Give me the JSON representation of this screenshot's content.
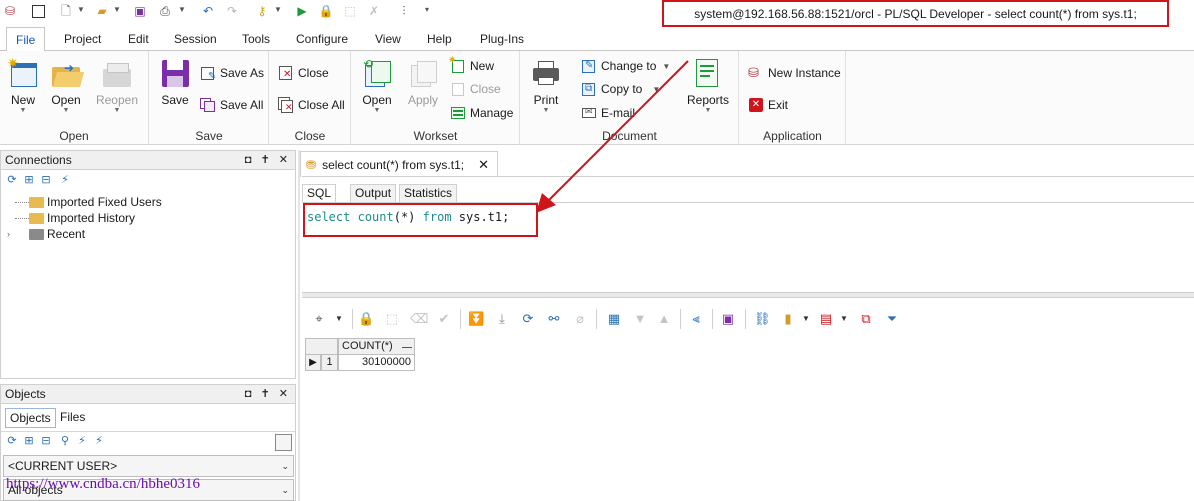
{
  "window": {
    "title": "system@192.168.56.88:1521/orcl - PL/SQL Developer - select count(*) from sys.t1;"
  },
  "ribbon_tabs": [
    "File",
    "Project",
    "Edit",
    "Session",
    "Tools",
    "Configure",
    "View",
    "Help",
    "Plug-Ins"
  ],
  "ribbon": {
    "open_group": {
      "caption": "Open",
      "new": "New",
      "open": "Open",
      "reopen": "Reopen"
    },
    "save_group": {
      "caption": "Save",
      "save": "Save",
      "save_as": "Save As",
      "save_all": "Save All"
    },
    "close_group": {
      "caption": "Close",
      "close": "Close",
      "close_all": "Close All"
    },
    "workset_group": {
      "caption": "Workset",
      "open": "Open",
      "apply": "Apply",
      "new": "New",
      "close": "Close",
      "manage": "Manage"
    },
    "document_group": {
      "caption": "Document",
      "print": "Print",
      "change_to": "Change to",
      "copy_to": "Copy to",
      "email": "E-mail",
      "reports": "Reports"
    },
    "application_group": {
      "caption": "Application",
      "new_instance": "New Instance",
      "exit": "Exit"
    }
  },
  "connections": {
    "title": "Connections",
    "controls": "◘ ✝ ✕",
    "items": [
      {
        "label": "Imported Fixed Users"
      },
      {
        "label": "Imported History"
      },
      {
        "label": "Recent"
      }
    ]
  },
  "objects": {
    "title": "Objects",
    "controls": "◘ ✝ ✕",
    "tabs": [
      "Objects",
      "Files"
    ],
    "user_combo": "<CURRENT USER>",
    "filter_combo": "All objects"
  },
  "editor": {
    "doc_tab_label": "select count(*) from sys.t1;",
    "sub_tabs": [
      "SQL",
      "Output",
      "Statistics"
    ],
    "sql": {
      "kw_select": "select",
      "fn_count": "count",
      "paren": "(*)",
      "kw_from": "from",
      "object": "sys.t1;"
    }
  },
  "result_grid": {
    "columns": [
      "COUNT(*)"
    ],
    "rows": [
      {
        "num": "1",
        "values": [
          "30100000"
        ]
      }
    ]
  },
  "watermark": "https://www.cndba.cn/hbhe0316",
  "colors": {
    "annotation_red": "#d0141b",
    "accent_blue": "#1a56b8",
    "sql_keyword": "#1f8c8c"
  }
}
